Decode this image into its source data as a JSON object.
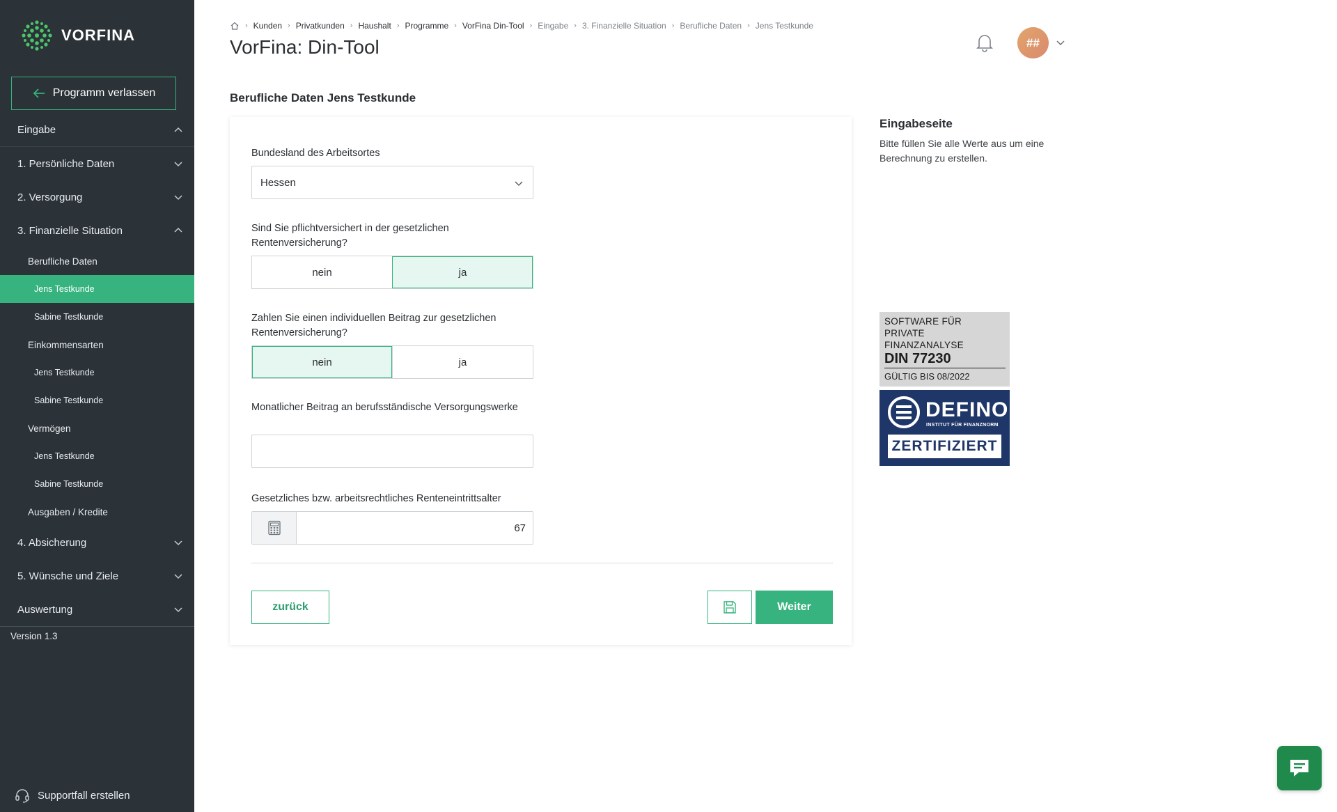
{
  "app": {
    "logo_text": "VORFINA",
    "exit_label": "Programm verlassen",
    "version": "Version 1.3",
    "support_label": "Supportfall erstellen"
  },
  "nav": {
    "eingabe": "Eingabe",
    "persoenliche": "1. Persönliche Daten",
    "versorgung": "2. Versorgung",
    "finanzielle": "3. Finanzielle Situation",
    "berufliche": "Berufliche Daten",
    "berufliche_jens": "Jens Testkunde",
    "berufliche_sabine": "Sabine Testkunde",
    "einkommen": "Einkommensarten",
    "einkommen_jens": "Jens Testkunde",
    "einkommen_sabine": "Sabine Testkunde",
    "vermoegen": "Vermögen",
    "vermoegen_jens": "Jens Testkunde",
    "vermoegen_sabine": "Sabine Testkunde",
    "ausgaben": "Ausgaben / Kredite",
    "absicherung": "4. Absicherung",
    "wuensche": "5. Wünsche und Ziele",
    "auswertung": "Auswertung"
  },
  "breadcrumb": [
    "Kunden",
    "Privatkunden",
    "Haushalt",
    "Programme",
    "VorFina Din-Tool",
    "Eingabe",
    "3. Finanzielle Situation",
    "Berufliche Daten",
    "Jens Testkunde"
  ],
  "header": {
    "title": "VorFina: Din-Tool",
    "avatar_initials": "##"
  },
  "form": {
    "section_title": "Berufliche Daten Jens Testkunde",
    "bundesland_label": "Bundesland des Arbeitsortes",
    "bundesland_value": "Hessen",
    "pflicht_label": "Sind Sie pflichtversichert in der gesetzlichen Rentenversicherung?",
    "pflicht_no": "nein",
    "pflicht_yes": "ja",
    "pflicht_selected": "ja",
    "beitrag_label": "Zahlen Sie einen individuellen Beitrag zur gesetzlichen Rentenversicherung?",
    "beitrag_no": "nein",
    "beitrag_yes": "ja",
    "beitrag_selected": "nein",
    "versorgungswerk_label": "Monatlicher Beitrag an berufsständische Versorgungswerke",
    "versorgungswerk_value": "",
    "rentenalter_label": "Gesetzliches bzw. arbeitsrechtliches Renteneintrittsalter",
    "rentenalter_value": "67",
    "back_label": "zurück",
    "next_label": "Weiter"
  },
  "info": {
    "title": "Eingabeseite",
    "text": "Bitte füllen Sie alle Werte aus um eine Berechnung zu erstellen."
  },
  "cert": {
    "line1": "SOFTWARE FÜR",
    "line2": "PRIVATE FINANZANALYSE",
    "din": "DIN 77230",
    "valid": "GÜLTIG BIS 08/2022",
    "brand": "DEFINO",
    "sub": "INSTITUT FÜR FINANZNORM",
    "zert": "ZERTIFIZIERT"
  },
  "colors": {
    "sidebar": "#2b3238",
    "accent": "#36b37e",
    "selected_bg": "#e6f6f0",
    "cert_blue": "#1f3668",
    "chat": "#1f8a4c"
  }
}
